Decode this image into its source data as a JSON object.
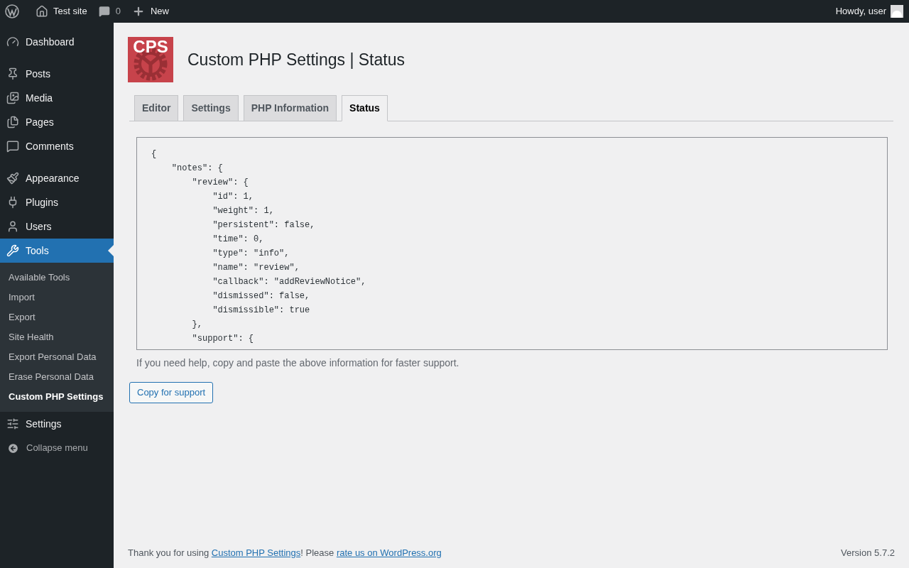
{
  "admin_bar": {
    "site_name": "Test site",
    "comments_count": "0",
    "new_label": "New",
    "greeting": "Howdy, user"
  },
  "menu_groups": [
    [
      {
        "label": "Dashboard",
        "selected": false
      }
    ],
    [
      {
        "label": "Posts",
        "selected": false
      },
      {
        "label": "Media",
        "selected": false
      },
      {
        "label": "Pages",
        "selected": false
      },
      {
        "label": "Comments",
        "selected": false
      }
    ],
    [
      {
        "label": "Appearance",
        "selected": false
      },
      {
        "label": "Plugins",
        "selected": false
      },
      {
        "label": "Users",
        "selected": false
      },
      {
        "label": "Tools",
        "selected": true,
        "submenu": [
          {
            "label": "Available Tools",
            "selected": false
          },
          {
            "label": "Import",
            "selected": false
          },
          {
            "label": "Export",
            "selected": false
          },
          {
            "label": "Site Health",
            "selected": false
          },
          {
            "label": "Export Personal Data",
            "selected": false
          },
          {
            "label": "Erase Personal Data",
            "selected": false
          },
          {
            "label": "Custom PHP Settings",
            "selected": true
          }
        ]
      },
      {
        "label": "Settings",
        "selected": false
      }
    ]
  ],
  "collapse_label": "Collapse menu",
  "plugin": {
    "logo_text": "CPS",
    "title": "Custom PHP Settings | Status"
  },
  "tabs": [
    {
      "label": "Editor",
      "selected": false
    },
    {
      "label": "Settings",
      "selected": false
    },
    {
      "label": "PHP Information",
      "selected": false
    },
    {
      "label": "Status",
      "selected": true
    }
  ],
  "status_lines": [
    "{",
    "    \"notes\": {",
    "        \"review\": {",
    "            \"id\": 1,",
    "            \"weight\": 1,",
    "            \"persistent\": false,",
    "            \"time\": 0,",
    "            \"type\": \"info\",",
    "            \"name\": \"review\",",
    "            \"callback\": \"addReviewNotice\",",
    "            \"dismissed\": false,",
    "            \"dismissible\": true",
    "        },",
    "        \"support\": {"
  ],
  "help_text": "If you need help, copy and paste the above information for faster support.",
  "copy_button": "Copy for support",
  "footer": {
    "before": "Thank you for using ",
    "link_1": "Custom PHP Settings",
    "middle": "! Please ",
    "link_2": "rate us on WordPress.org",
    "version": "Version 5.7.2"
  }
}
